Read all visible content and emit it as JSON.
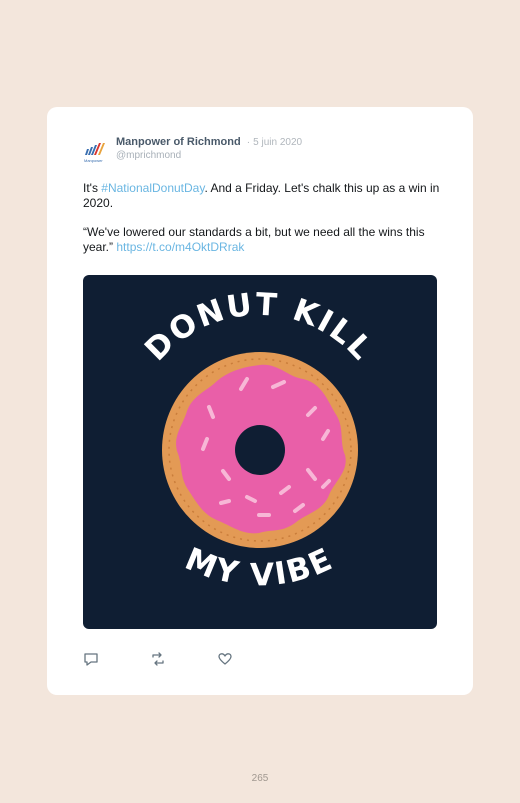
{
  "tweet": {
    "author_name": "Manpower of Richmond",
    "separator": "·",
    "date": "5 juin 2020",
    "handle": "@mprichmond",
    "logo_caption": "Manpower",
    "line1_prefix": "It's ",
    "hashtag": "#NationalDonutDay",
    "line1_suffix": ". And a Friday. Let's chalk this up as a win in 2020.",
    "line2": "“We've lowered our standards a bit, but we need all the wins this year.” ",
    "link": "https://t.co/m4OktDRrak"
  },
  "image": {
    "top_text": "DONUT KILL",
    "bottom_text": "MY VIBE"
  },
  "actions": {
    "reply_icon": "reply-icon",
    "retweet_icon": "retweet-icon",
    "like_icon": "heart-icon"
  },
  "page": {
    "number": "265"
  },
  "colors": {
    "background": "#f3e6dc",
    "card": "#ffffff",
    "link": "#6ab6e2",
    "image_bg": "#0f1e33",
    "donut_dough": "#e39a55",
    "donut_icing": "#e95fa8"
  }
}
